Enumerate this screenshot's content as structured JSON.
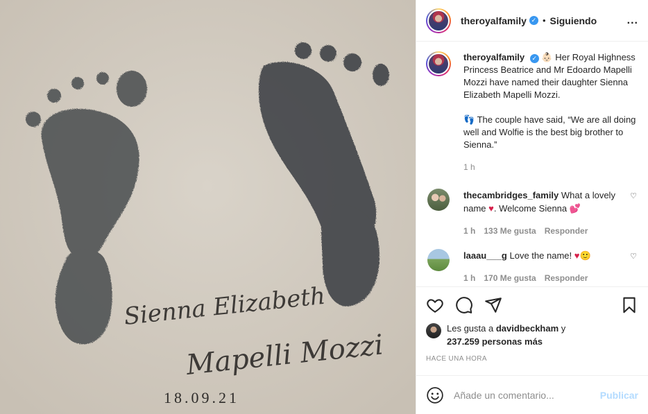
{
  "media": {
    "script_name_line1": "Sienna Elizabeth",
    "script_name_line2": "Mapelli Mozzi",
    "date": "18.09.21"
  },
  "header": {
    "username": "theroyalfamily",
    "verified_icon": "check-badge-icon",
    "separator": "•",
    "follow_status": "Siguiendo",
    "more_label": "..."
  },
  "caption": {
    "username": "theroyalfamily",
    "text1": "👶🏻 Her Royal Highness Princess Beatrice and Mr Edoardo Mapelli Mozzi have named their daughter Sienna Elizabeth Mapelli Mozzi.",
    "text2": "👣 The couple have said, “We are all doing well and Wolfie is the best big brother to Sienna.”",
    "time": "1 h"
  },
  "comments": [
    {
      "username": "thecambridges_family",
      "text_before": "What a lovely name",
      "heart": "♥",
      "text_after": ". Welcome Sienna",
      "heart2": "💕",
      "time": "1 h",
      "likes": "133 Me gusta",
      "reply": "Responder"
    },
    {
      "username": "laaau___g",
      "text": "Love the name!",
      "emoji": "♥🙂",
      "time": "1 h",
      "likes": "170 Me gusta",
      "reply": "Responder"
    }
  ],
  "likes": {
    "prefix": "Les gusta a",
    "user": "davidbeckham",
    "conj": "y",
    "count": "237.259 personas más"
  },
  "timestamp": "Hace una hora",
  "add_comment": {
    "placeholder": "Añade un comentario...",
    "publish": "Publicar"
  },
  "colors": {
    "accent_blue": "#3897f0",
    "publish_disabled": "#b3dbff",
    "heart_red": "#d6204a",
    "muted": "#8e8e8e"
  }
}
